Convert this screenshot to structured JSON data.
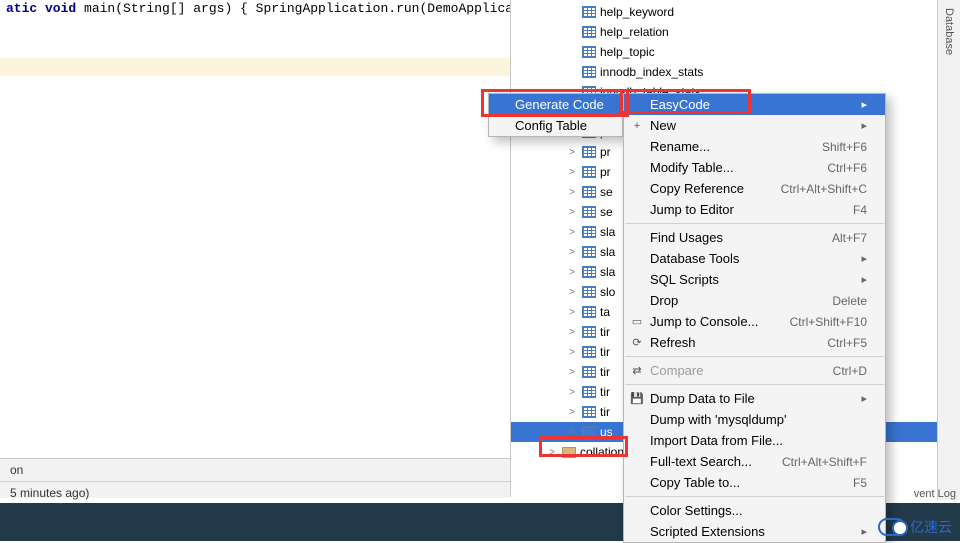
{
  "editor": {
    "code_line": "atic void main(String[] args) { SpringApplication.run(DemoApplication.cl"
  },
  "status": {
    "line1": "on",
    "line2": "5 minutes ago)"
  },
  "db_side_label": "Database",
  "tree": {
    "items": [
      {
        "expand": "",
        "label": "help_keyword",
        "type": "table"
      },
      {
        "expand": "",
        "label": "help_relation",
        "type": "table"
      },
      {
        "expand": "",
        "label": "help_topic",
        "type": "table"
      },
      {
        "expand": "",
        "label": "innodb_index_stats",
        "type": "table"
      },
      {
        "expand": "",
        "label": "innodb_table_stats",
        "type": "table"
      },
      {
        "expand": ">",
        "label": "pr",
        "type": "table"
      },
      {
        "expand": ">",
        "label": "pr",
        "type": "table"
      },
      {
        "expand": ">",
        "label": "pr",
        "type": "table"
      },
      {
        "expand": ">",
        "label": "pr",
        "type": "table"
      },
      {
        "expand": ">",
        "label": "se",
        "type": "table"
      },
      {
        "expand": ">",
        "label": "se",
        "type": "table"
      },
      {
        "expand": ">",
        "label": "sla",
        "type": "table"
      },
      {
        "expand": ">",
        "label": "sla",
        "type": "table"
      },
      {
        "expand": ">",
        "label": "sla",
        "type": "table"
      },
      {
        "expand": ">",
        "label": "slo",
        "type": "table"
      },
      {
        "expand": ">",
        "label": "ta",
        "type": "table"
      },
      {
        "expand": ">",
        "label": "tir",
        "type": "table"
      },
      {
        "expand": ">",
        "label": "tir",
        "type": "table"
      },
      {
        "expand": ">",
        "label": "tir",
        "type": "table"
      },
      {
        "expand": ">",
        "label": "tir",
        "type": "table"
      },
      {
        "expand": ">",
        "label": "tir",
        "type": "table"
      },
      {
        "expand": ">",
        "label": "us",
        "type": "table",
        "selected": true
      },
      {
        "expand": ">",
        "label": "collations",
        "type": "folder"
      }
    ]
  },
  "menu1": {
    "generate_code": "Generate Code",
    "config_table": "Config Table"
  },
  "menu2": {
    "easycode": "EasyCode",
    "new": "New",
    "rename": {
      "label": "Rename...",
      "shortcut": "Shift+F6"
    },
    "modify_table": {
      "label": "Modify Table...",
      "shortcut": "Ctrl+F6"
    },
    "copy_reference": {
      "label": "Copy Reference",
      "shortcut": "Ctrl+Alt+Shift+C"
    },
    "jump_to_editor": {
      "label": "Jump to Editor",
      "shortcut": "F4"
    },
    "find_usages": {
      "label": "Find Usages",
      "shortcut": "Alt+F7"
    },
    "database_tools": "Database Tools",
    "sql_scripts": "SQL Scripts",
    "drop": {
      "label": "Drop",
      "shortcut": "Delete"
    },
    "jump_to_console": {
      "label": "Jump to Console...",
      "shortcut": "Ctrl+Shift+F10"
    },
    "refresh": {
      "label": "Refresh",
      "shortcut": "Ctrl+F5"
    },
    "compare": {
      "label": "Compare",
      "shortcut": "Ctrl+D"
    },
    "dump_to_file": "Dump Data to File",
    "dump_mysqldump": "Dump with 'mysqldump'",
    "import_data": "Import Data from File...",
    "fulltext_search": {
      "label": "Full-text Search...",
      "shortcut": "Ctrl+Alt+Shift+F"
    },
    "copy_table_to": {
      "label": "Copy Table to...",
      "shortcut": "F5"
    },
    "color_settings": "Color Settings...",
    "scripted_extensions": "Scripted Extensions"
  },
  "event_log": "vent Log",
  "logo_text": "亿速云"
}
